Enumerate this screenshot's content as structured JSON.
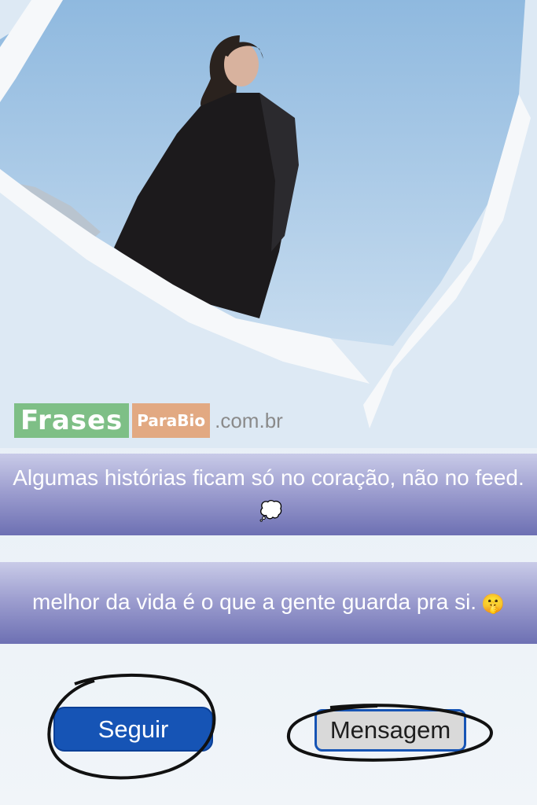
{
  "watermark": {
    "brand_part1": "Frases",
    "brand_part2": "ParaBio",
    "domain": ".com.br"
  },
  "bio_lines": [
    {
      "text": "Algumas histórias ficam só no coração, não no feed.",
      "emoji": "💭",
      "icon": "thought-balloon-icon"
    },
    {
      "text": "melhor da vida é o que a gente guarda pra si.",
      "emoji": "🤫",
      "icon": "shushing-face-icon"
    }
  ],
  "actions": {
    "follow_label": "Seguir",
    "message_label": "Mensagem"
  },
  "colors": {
    "follow_button": "#1654b5",
    "message_button": "#d9d9d9",
    "band_bottom": "#6d70b3",
    "sky": "#a9cbe7"
  }
}
